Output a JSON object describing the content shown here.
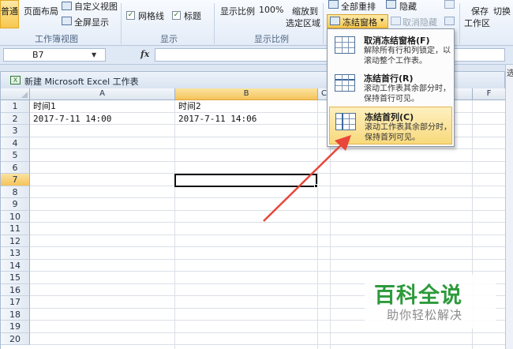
{
  "ribbon": {
    "normal_label": "普通",
    "page_layout_label": "页面布局",
    "custom_view_label": "自定义视图",
    "fullscreen_label": "全屏显示",
    "workbook_views_group": "工作簿视图",
    "gridlines_label": "网格线",
    "headings_label": "标题",
    "gridlines_checked": true,
    "headings_checked": true,
    "show_group": "显示",
    "zoom_label": "显示比例",
    "zoom_value": "100%",
    "zoom_to_selection_line1": "缩放到",
    "zoom_to_selection_line2": "选定区域",
    "zoom_group": "显示比例",
    "arrange_all_label": "全部重排",
    "hide_label": "隐藏",
    "freeze_panes_label": "冻结窗格",
    "unhide_label": "取消隐藏",
    "save_workspace_label1": "保存",
    "save_workspace_label2": "工作区",
    "switch_label": "切换"
  },
  "formula_bar": {
    "name_box": "B7",
    "fx": "fx",
    "formula": ""
  },
  "workbook": {
    "title": "新建 Microsoft Excel 工作表",
    "right_pane_text": "选"
  },
  "sheet": {
    "columns": [
      "A",
      "B",
      "C",
      "F"
    ],
    "rows": [
      "1",
      "2",
      "3",
      "4",
      "5",
      "6",
      "7",
      "8",
      "9",
      "10",
      "11",
      "12",
      "13",
      "14",
      "15",
      "16",
      "17",
      "18",
      "19",
      "20"
    ],
    "selected_cell": "B7",
    "cells": {
      "A1": "时间1",
      "B1": "时间2",
      "A2": "2017-7-11 14:00",
      "B2": "2017-7-11 14:06"
    }
  },
  "freeze_menu": {
    "items": [
      {
        "title": "取消冻结窗格(F)",
        "desc": "解除所有行和列锁定，以滚动整个工作表。",
        "active": false
      },
      {
        "title": "冻结首行(R)",
        "desc": "滚动工作表其余部分时，保持首行可见。",
        "active": false
      },
      {
        "title": "冻结首列(C)",
        "desc": "滚动工作表其余部分时，保持首列可见。",
        "active": true
      }
    ]
  },
  "watermark": {
    "main": "百科全说",
    "sub": "助你轻松解决"
  },
  "colors": {
    "accent_arrow": "#e8473a",
    "watermark_green": "#2d9a3c",
    "highlight": "#f8d97c"
  }
}
